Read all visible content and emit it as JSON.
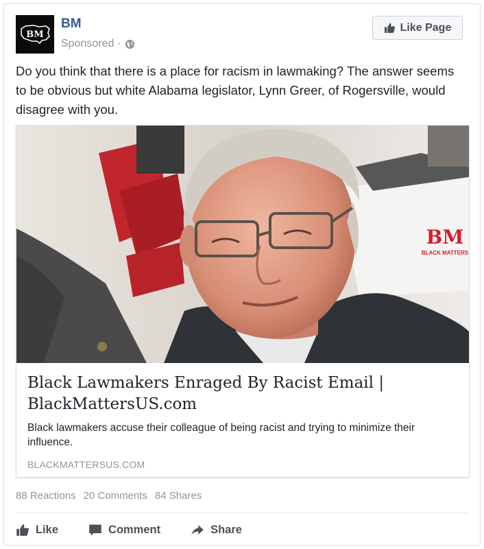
{
  "post": {
    "page_name": "BM",
    "sponsored_label": "Sponsored",
    "separator": "·",
    "like_page_label": "Like Page",
    "avatar_text": "BM",
    "text": "Do you think that there is a place for racism in lawmaking? The answer seems to be obvious but white Alabama legislator, Lynn Greer, of Rogersville, would disagree with you."
  },
  "link": {
    "image_logo": "BM",
    "image_logo_sub": "BLACK MATTERS",
    "title": "Black Lawmakers Enraged By Racist Email | BlackMattersUS.com",
    "description": "Black lawmakers accuse their colleague of being racist and trying to minimize their influence.",
    "domain": "BLACKMATTERSUS.COM"
  },
  "stats": {
    "reactions": "88 Reactions",
    "comments": "20 Comments",
    "shares": "84 Shares"
  },
  "actions": {
    "like": "Like",
    "comment": "Comment",
    "share": "Share"
  },
  "colors": {
    "page_name": "#365899",
    "meta_gray": "#90949c",
    "action_gray": "#4b4f56",
    "logo_red": "#d81c2a"
  },
  "icons": {
    "avatar": "bm-map-logo",
    "privacy": "globe-icon",
    "like_page": "thumbs-up-icon",
    "like": "thumbs-up-icon",
    "comment": "speech-bubble-icon",
    "share": "share-arrow-icon"
  }
}
